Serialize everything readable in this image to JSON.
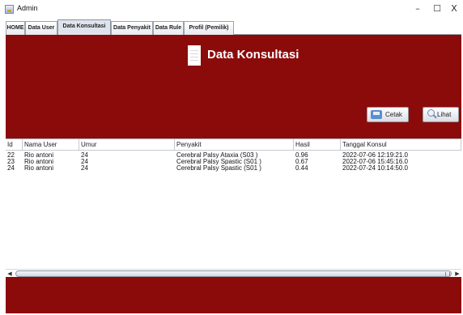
{
  "window": {
    "title": "Admin",
    "controls": {
      "minimize": "–",
      "maximize": "☐",
      "close": "X"
    }
  },
  "tabs": [
    {
      "label": "HOME"
    },
    {
      "label": "Data User"
    },
    {
      "label": "Data Konsultasi",
      "active": true
    },
    {
      "label": "Data Penyakit"
    },
    {
      "label": "Data Rule"
    },
    {
      "label": "Profil (Pemilik)"
    }
  ],
  "header": {
    "title": "Data Konsultasi",
    "icon": "document-icon"
  },
  "buttons": {
    "cetak": {
      "label": "Cetak",
      "icon": "printer-icon"
    },
    "lihat": {
      "label": "Lihat",
      "icon": "search-icon"
    }
  },
  "table": {
    "columns": [
      "Id",
      "Nama User",
      "Umur",
      "Penyakit",
      "Hasil",
      "Tanggal Konsul"
    ],
    "rows": [
      [
        "22",
        "Rio antoni",
        "24",
        "Cerebral Palsy Ataxia (S03 )",
        "0.96",
        "2022-07-06 12:19:21.0"
      ],
      [
        "23",
        "Rio antoni",
        "24",
        "Cerebral Palsy Spastic (S01 )",
        "0.67",
        "2022-07-06 15:45:16.0"
      ],
      [
        "24",
        "Rio antoni",
        "24",
        "Cerebral Palsy Spastic (S01 )",
        "0.44",
        "2022-07-24 10:14:50.0"
      ]
    ]
  },
  "scrollbar": {
    "left_arrow": "◀",
    "right_arrow": "▶"
  },
  "colors": {
    "panel_bg": "#8b0b0b",
    "header_text": "#ffffff"
  }
}
